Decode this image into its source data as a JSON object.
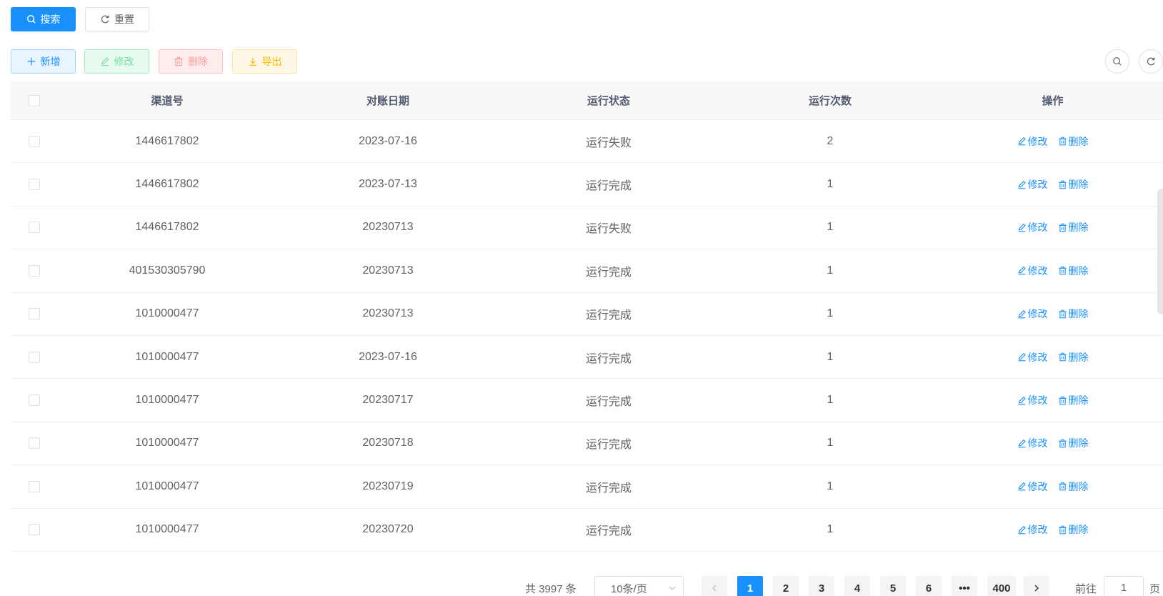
{
  "search": {
    "search_label": "搜索",
    "reset_label": "重置"
  },
  "toolbar": {
    "add_label": "新增",
    "edit_label": "修改",
    "delete_label": "删除",
    "export_label": "导出"
  },
  "table": {
    "headers": [
      "渠道号",
      "对账日期",
      "运行状态",
      "运行次数",
      "操作"
    ],
    "rows": [
      {
        "channel": "1446617802",
        "date": "2023-07-16",
        "status": "运行失败",
        "count": "2"
      },
      {
        "channel": "1446617802",
        "date": "2023-07-13",
        "status": "运行完成",
        "count": "1"
      },
      {
        "channel": "1446617802",
        "date": "20230713",
        "status": "运行失败",
        "count": "1"
      },
      {
        "channel": "401530305790",
        "date": "20230713",
        "status": "运行完成",
        "count": "1"
      },
      {
        "channel": "1010000477",
        "date": "20230713",
        "status": "运行完成",
        "count": "1"
      },
      {
        "channel": "1010000477",
        "date": "2023-07-16",
        "status": "运行完成",
        "count": "1"
      },
      {
        "channel": "1010000477",
        "date": "20230717",
        "status": "运行完成",
        "count": "1"
      },
      {
        "channel": "1010000477",
        "date": "20230718",
        "status": "运行完成",
        "count": "1"
      },
      {
        "channel": "1010000477",
        "date": "20230719",
        "status": "运行完成",
        "count": "1"
      },
      {
        "channel": "1010000477",
        "date": "20230720",
        "status": "运行完成",
        "count": "1"
      }
    ],
    "row_edit_label": "修改",
    "row_delete_label": "删除"
  },
  "pagination": {
    "total_text": "共 3997 条",
    "page_size": "10条/页",
    "pages": [
      "1",
      "2",
      "3",
      "4",
      "5",
      "6",
      "•••",
      "400"
    ],
    "current_page": "1",
    "goto_label": "前往",
    "goto_value": "1",
    "goto_suffix": "页"
  },
  "colors": {
    "primary": "#1890ff",
    "success": "#13ce66",
    "danger": "#ff4949",
    "warning": "#ffba00"
  }
}
